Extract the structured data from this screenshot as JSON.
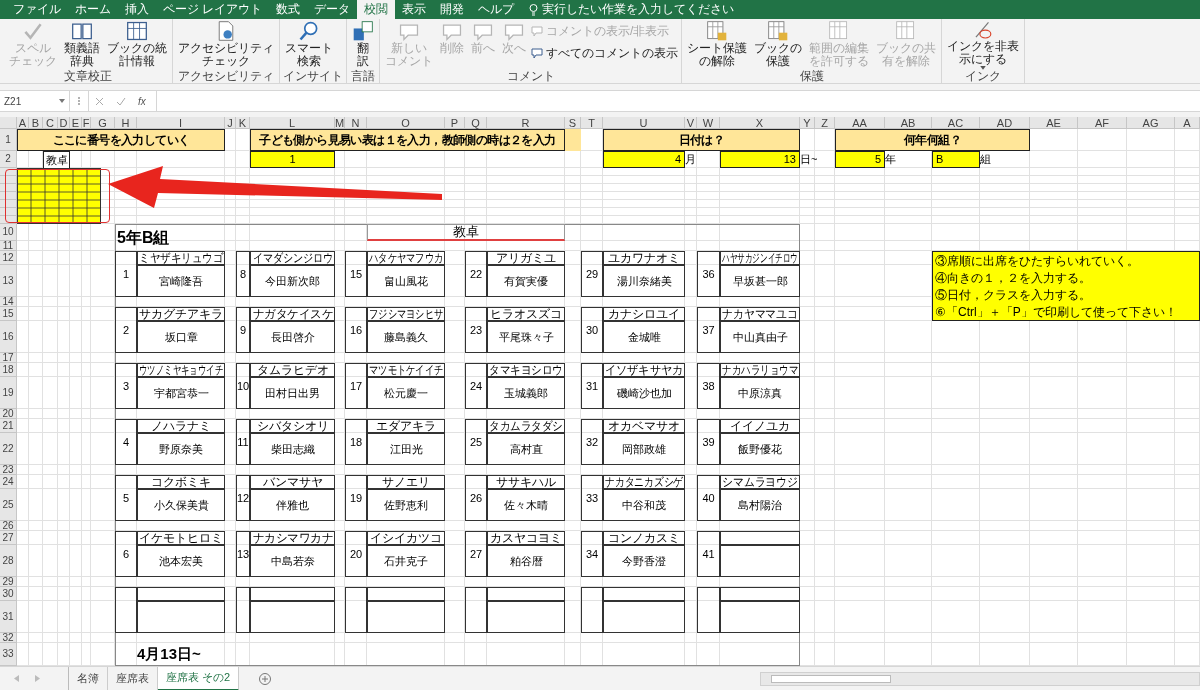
{
  "ribbon_tabs": [
    {
      "label": "ファイル",
      "selected": false
    },
    {
      "label": "ホーム",
      "selected": false
    },
    {
      "label": "挿入",
      "selected": false
    },
    {
      "label": "ページ レイアウト",
      "selected": false
    },
    {
      "label": "数式",
      "selected": false
    },
    {
      "label": "データ",
      "selected": false
    },
    {
      "label": "校閲",
      "selected": true
    },
    {
      "label": "表示",
      "selected": false
    },
    {
      "label": "開発",
      "selected": false
    },
    {
      "label": "ヘルプ",
      "selected": false
    }
  ],
  "tell_me": "実行したい作業を入力してください",
  "ribbon_groups": [
    {
      "label": "文章校正",
      "buttons": [
        {
          "kind": "large",
          "lines": [
            "スペル",
            "チェック"
          ],
          "disabled": true
        },
        {
          "kind": "large",
          "lines": [
            "類義語",
            "辞典"
          ],
          "disabled": false
        },
        {
          "kind": "large",
          "lines": [
            "ブックの統",
            "計情報"
          ],
          "disabled": false
        }
      ]
    },
    {
      "label": "アクセシビリティ",
      "buttons": [
        {
          "kind": "large",
          "lines": [
            "アクセシビリティ",
            "チェック"
          ],
          "disabled": false
        }
      ]
    },
    {
      "label": "インサイト",
      "buttons": [
        {
          "kind": "large",
          "lines": [
            "スマート",
            "検索"
          ],
          "disabled": false
        }
      ]
    },
    {
      "label": "言語",
      "buttons": [
        {
          "kind": "large",
          "lines": [
            "翻",
            "訳"
          ],
          "disabled": false
        }
      ]
    },
    {
      "label": "コメント",
      "buttons": [
        {
          "kind": "large",
          "lines": [
            "新しい",
            "コメント"
          ],
          "disabled": true
        },
        {
          "kind": "large",
          "lines": [
            "削除"
          ],
          "disabled": true
        },
        {
          "kind": "large",
          "lines": [
            "前へ"
          ],
          "disabled": true
        },
        {
          "kind": "large",
          "lines": [
            "次へ"
          ],
          "disabled": true
        },
        {
          "kind": "small",
          "lines": [
            "コメントの表示/非表示"
          ],
          "disabled": true
        },
        {
          "kind": "small",
          "lines": [
            "すべてのコメントの表示"
          ],
          "disabled": false
        }
      ]
    },
    {
      "label": "保護",
      "buttons": [
        {
          "kind": "large",
          "lines": [
            "シート保護",
            "の解除"
          ],
          "disabled": false
        },
        {
          "kind": "large",
          "lines": [
            "ブックの",
            "保護"
          ],
          "disabled": false
        },
        {
          "kind": "large",
          "lines": [
            "範囲の編集",
            "を許可する"
          ],
          "disabled": true
        },
        {
          "kind": "large",
          "lines": [
            "ブックの共",
            "有を解除"
          ],
          "disabled": true
        }
      ]
    },
    {
      "label": "インク",
      "buttons": [
        {
          "kind": "large",
          "lines": [
            "インクを非表",
            "示にする"
          ],
          "disabled": false,
          "dropdown": true
        }
      ]
    }
  ],
  "formula_bar": {
    "name_box": "Z21",
    "function_button": "fx"
  },
  "columns": [
    "A",
    "B",
    "C",
    "D",
    "E",
    "F",
    "G",
    "H",
    "I",
    "J",
    "K",
    "L",
    "M",
    "N",
    "O",
    "P",
    "Q",
    "R",
    "S",
    "T",
    "U",
    "V",
    "W",
    "X",
    "Y",
    "Z",
    "AA",
    "AB",
    "AC",
    "AD",
    "AE",
    "AF",
    "AG",
    "A"
  ],
  "row_headers": [
    {
      "kind": "label",
      "label": "1"
    },
    {
      "kind": "label",
      "label": "2"
    },
    {
      "kind": "collapsed"
    },
    {
      "kind": "collapsed"
    },
    {
      "kind": "collapsed"
    },
    {
      "kind": "collapsed"
    },
    {
      "kind": "collapsed"
    },
    {
      "kind": "collapsed"
    },
    {
      "kind": "collapsed"
    },
    {
      "kind": "label",
      "label": "10"
    },
    {
      "kind": "label",
      "label": "11"
    },
    {
      "kind": "label",
      "label": "12"
    },
    {
      "kind": "label",
      "label": "13"
    },
    {
      "kind": "label",
      "label": "14"
    },
    {
      "kind": "label",
      "label": "15"
    },
    {
      "kind": "label",
      "label": "16"
    },
    {
      "kind": "label",
      "label": "17"
    },
    {
      "kind": "label",
      "label": "18"
    },
    {
      "kind": "label",
      "label": "19"
    },
    {
      "kind": "label",
      "label": "20"
    },
    {
      "kind": "label",
      "label": "21"
    },
    {
      "kind": "label",
      "label": "22"
    },
    {
      "kind": "label",
      "label": "23"
    },
    {
      "kind": "label",
      "label": "24"
    },
    {
      "kind": "label",
      "label": "25"
    },
    {
      "kind": "label",
      "label": "26"
    },
    {
      "kind": "label",
      "label": "27"
    },
    {
      "kind": "label",
      "label": "28"
    },
    {
      "kind": "label",
      "label": "29"
    },
    {
      "kind": "label",
      "label": "30"
    },
    {
      "kind": "label",
      "label": "31"
    },
    {
      "kind": "label",
      "label": "32"
    },
    {
      "kind": "label",
      "label": "33"
    }
  ],
  "instruction_headers": [
    "ここに番号を入力していく",
    "子ども側から見易い表は１を入力，教師側の時は２を入力",
    "日付は？",
    "何年何組？"
  ],
  "small_desk_label": "教卓",
  "inputs": {
    "orientation": "1",
    "month": "4",
    "month_unit": "月",
    "day": "13",
    "day_unit": "日~",
    "grade": "5",
    "grade_unit": "年",
    "class": "B",
    "class_unit": "組"
  },
  "class_title": "5年B組",
  "teacher_desk": "教卓",
  "seat_columns": [
    [
      {
        "number": "1",
        "kana": "ミヤザキリュウゴ",
        "name": "宮崎隆吾"
      },
      {
        "number": "2",
        "kana": "サカグチアキラ",
        "name": "坂口章"
      },
      {
        "number": "3",
        "kana": "ウツノミヤキョウイチ",
        "name": "宇都宮恭一"
      },
      {
        "number": "4",
        "kana": "ノハラナミ",
        "name": "野原奈美"
      },
      {
        "number": "5",
        "kana": "コクボミキ",
        "name": "小久保美貴"
      },
      {
        "number": "6",
        "kana": "イケモトヒロミ",
        "name": "池本宏美"
      },
      {}
    ],
    [
      {
        "number": "8",
        "kana": "イマダシンジロウ",
        "name": "今田新次郎"
      },
      {
        "number": "9",
        "kana": "ナガタケイスケ",
        "name": "長田啓介"
      },
      {
        "number": "10",
        "kana": "タムラヒデオ",
        "name": "田村日出男"
      },
      {
        "number": "11",
        "kana": "シバタシオリ",
        "name": "柴田志織"
      },
      {
        "number": "12",
        "kana": "バンマサヤ",
        "name": "伴雅也"
      },
      {
        "number": "13",
        "kana": "ナカシマワカナ",
        "name": "中島若奈"
      },
      {}
    ],
    [
      {
        "number": "15",
        "kana": "ハタケヤマフウカ",
        "name": "畠山風花"
      },
      {
        "number": "16",
        "kana": "フジシマヨシヒサ",
        "name": "藤島義久"
      },
      {
        "number": "17",
        "kana": "マツモトケイイチ",
        "name": "松元慶一"
      },
      {
        "number": "18",
        "kana": "エダアキラ",
        "name": "江田光"
      },
      {
        "number": "19",
        "kana": "サノエリ",
        "name": "佐野恵利"
      },
      {
        "number": "20",
        "kana": "イシイカツコ",
        "name": "石井克子"
      },
      {}
    ],
    [
      {
        "number": "22",
        "kana": "アリガミユ",
        "name": "有賀実優"
      },
      {
        "number": "23",
        "kana": "ヒラオスズコ",
        "name": "平尾珠々子"
      },
      {
        "number": "24",
        "kana": "タマキヨシロウ",
        "name": "玉城義郎"
      },
      {
        "number": "25",
        "kana": "タカムラタダシ",
        "name": "高村直"
      },
      {
        "number": "26",
        "kana": "ササキハル",
        "name": "佐々木晴"
      },
      {
        "number": "27",
        "kana": "カスヤコヨミ",
        "name": "粕谷暦"
      },
      {}
    ],
    [
      {
        "number": "29",
        "kana": "ユカワナオミ",
        "name": "湯川奈緒美"
      },
      {
        "number": "30",
        "kana": "カナシロユイ",
        "name": "金城唯"
      },
      {
        "number": "31",
        "kana": "イソザキサヤカ",
        "name": "磯崎沙也加"
      },
      {
        "number": "32",
        "kana": "オカベマサオ",
        "name": "岡部政雄"
      },
      {
        "number": "33",
        "kana": "ナカタニカズシゲ",
        "name": "中谷和茂"
      },
      {
        "number": "34",
        "kana": "コンノカスミ",
        "name": "今野香澄"
      },
      {}
    ],
    [
      {
        "number": "36",
        "kana": "ハヤサカジンイチロウ",
        "name": "早坂甚一郎"
      },
      {
        "number": "37",
        "kana": "ナカヤママユコ",
        "name": "中山真由子"
      },
      {
        "number": "38",
        "kana": "ナカハラリョウマ",
        "name": "中原涼真"
      },
      {
        "number": "39",
        "kana": "イイノユカ",
        "name": "飯野優花"
      },
      {
        "number": "40",
        "kana": "シマムラヨウジ",
        "name": "島村陽治"
      },
      {
        "number": "41"
      },
      {}
    ]
  ],
  "notes": [
    "③席順に出席をひたすらいれていく。",
    "④向きの１，２を入力する。",
    "⑤日付，クラスを入力する。",
    "⑥「Ctrl」＋「P」で印刷して使って下さい！"
  ],
  "date_footer": "4月13日~",
  "sheet_tabs": [
    {
      "label": "名簿",
      "selected": false
    },
    {
      "label": "座席表",
      "selected": false
    },
    {
      "label": "座席表 その2",
      "selected": true
    }
  ]
}
